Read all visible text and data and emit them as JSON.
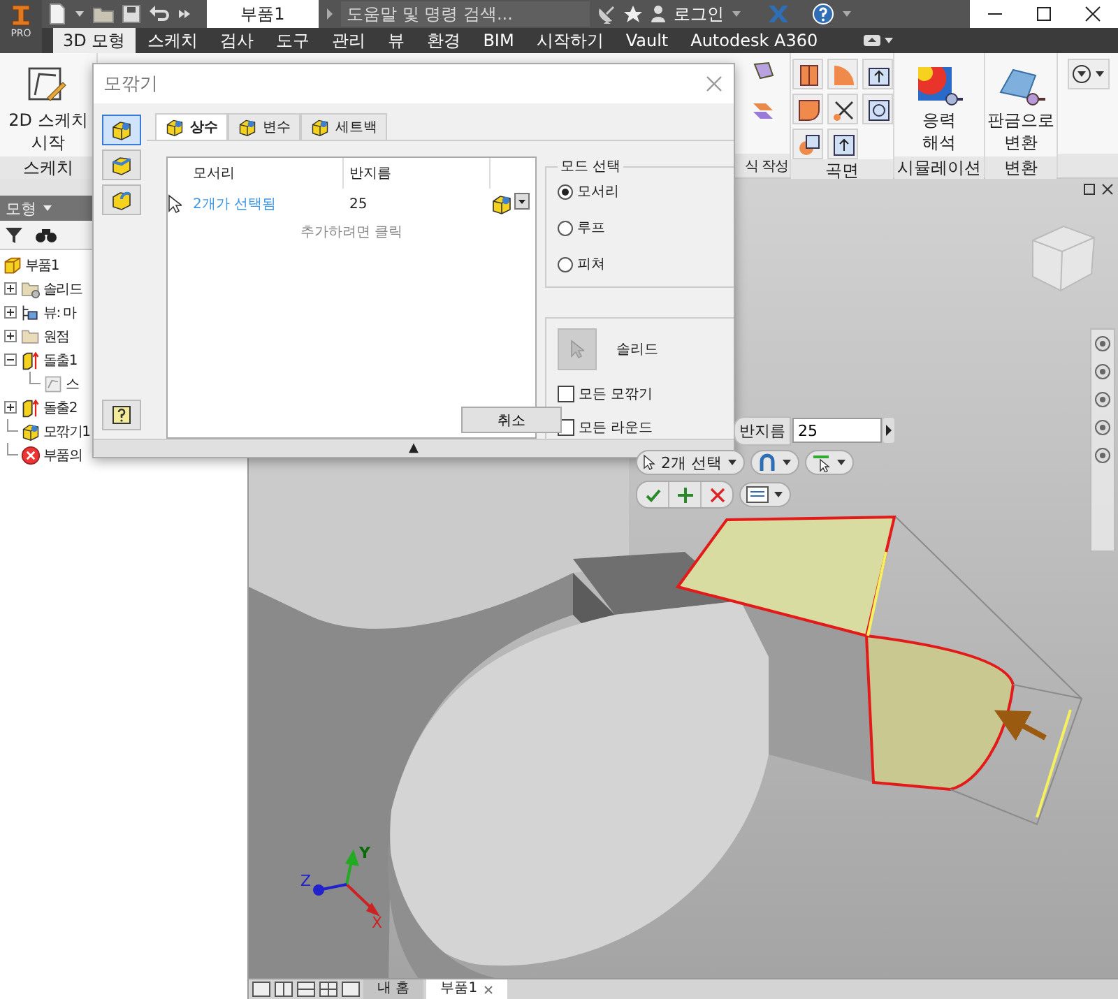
{
  "title_bar": {
    "app_badge": "PRO",
    "document_tab": "부품1",
    "search": {
      "placeholder": "도움말 및 명령 검색..."
    },
    "sign_in": "로그인"
  },
  "ribbon_tabs": [
    {
      "label": "3D 모형",
      "selected": true
    },
    {
      "label": "스케치",
      "selected": false
    },
    {
      "label": "검사",
      "selected": false
    },
    {
      "label": "도구",
      "selected": false
    },
    {
      "label": "관리",
      "selected": false
    },
    {
      "label": "뷰",
      "selected": false
    },
    {
      "label": "환경",
      "selected": false
    },
    {
      "label": "BIM",
      "selected": false
    },
    {
      "label": "시작하기",
      "selected": false
    },
    {
      "label": "Vault",
      "selected": false
    },
    {
      "label": "Autodesk A360",
      "selected": false
    }
  ],
  "ribbon_panels": [
    {
      "kind": "sketch",
      "label": "스케치",
      "button": [
        "2D 스케치",
        "시작"
      ]
    },
    {
      "kind": "pattern",
      "label": "식 작성"
    },
    {
      "kind": "surface",
      "label": "곡면"
    },
    {
      "kind": "simulation",
      "label": "시뮬레이션",
      "button": [
        "응력",
        "해석"
      ]
    },
    {
      "kind": "convert",
      "label": "변환",
      "button": [
        "판금으로",
        "변환"
      ]
    },
    {
      "kind": "more"
    }
  ],
  "browser": {
    "title": "모형",
    "tree": [
      {
        "kind": "part",
        "label": "부품1",
        "children": [
          {
            "kind": "solid-folder",
            "label": "솔리드",
            "expanded": false
          },
          {
            "kind": "view",
            "label": "뷰: 마",
            "expanded": false
          },
          {
            "kind": "folder",
            "label": "원점",
            "expanded": false
          },
          {
            "kind": "extrude",
            "label": "돌출1",
            "expanded": true,
            "children": [
              {
                "kind": "sketch",
                "label": "스"
              }
            ]
          },
          {
            "kind": "extrude",
            "label": "돌출2",
            "expanded": false
          },
          {
            "kind": "fillet",
            "label": "모깎기1"
          },
          {
            "kind": "end",
            "label": "부품의"
          }
        ]
      }
    ]
  },
  "canvas": {
    "axes": [
      "X",
      "Y",
      "Z"
    ]
  },
  "doc_tabs": [
    {
      "label": "내 홈",
      "selected": false
    },
    {
      "label": "부품1",
      "selected": true
    }
  ],
  "dialog": {
    "title": "모깎기",
    "side_buttons": [
      {
        "kind": "edge",
        "selected": true
      },
      {
        "kind": "face",
        "selected": false
      },
      {
        "kind": "full-round",
        "selected": false
      }
    ],
    "tabs": [
      {
        "label": "상수",
        "selected": true
      },
      {
        "label": "변수",
        "selected": false
      },
      {
        "label": "세트백",
        "selected": false
      }
    ],
    "table": {
      "columns": [
        "모서리",
        "반지름"
      ],
      "rows": [
        {
          "edges": "2개가 선택됨",
          "radius": "25"
        }
      ],
      "add_hint": "추가하려면 클릭"
    },
    "mode": {
      "title": "모드 선택",
      "options": [
        {
          "label": "모서리",
          "selected": true
        },
        {
          "label": "루프",
          "selected": false
        },
        {
          "label": "피쳐",
          "selected": false
        }
      ]
    },
    "solid_label": "솔리드",
    "options": [
      {
        "label": "모든 모깎기",
        "checked": false
      },
      {
        "label": "모든 라운드",
        "checked": false
      }
    ],
    "cancel": "취소",
    "expand_glyph": "▲"
  },
  "mini_toolbar": {
    "radius_label": "반지름",
    "radius_value": "25",
    "selection": "2개 선택"
  }
}
